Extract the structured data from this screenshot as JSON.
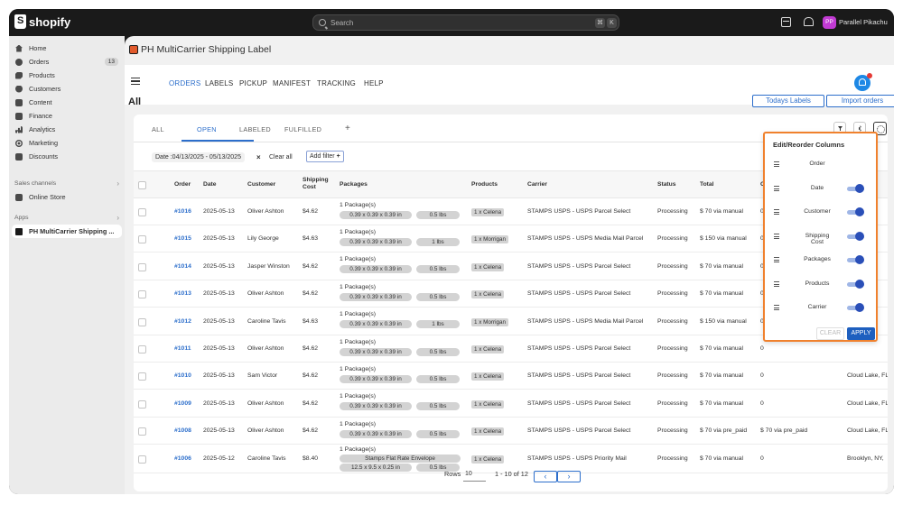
{
  "topbar": {
    "brand": "shopify",
    "search_placeholder": "Search",
    "shortcut": [
      "⌘",
      "K"
    ],
    "avatar_initials": "PP",
    "user_name": "Parallel Pikachu"
  },
  "sidebar": {
    "items": [
      {
        "label": "Home",
        "icon": "home-icon"
      },
      {
        "label": "Orders",
        "icon": "orders-icon",
        "badge": "13"
      },
      {
        "label": "Products",
        "icon": "tag-icon"
      },
      {
        "label": "Customers",
        "icon": "person-icon"
      },
      {
        "label": "Content",
        "icon": "content-icon"
      },
      {
        "label": "Finance",
        "icon": "finance-icon"
      },
      {
        "label": "Analytics",
        "icon": "analytics-icon"
      },
      {
        "label": "Marketing",
        "icon": "target-icon"
      },
      {
        "label": "Discounts",
        "icon": "discount-icon"
      }
    ],
    "sales_channels_label": "Sales channels",
    "online_store": "Online Store",
    "apps_label": "Apps",
    "app_item": "PH MultiCarrier Shipping ..."
  },
  "app": {
    "title": "PH MultiCarrier Shipping Label",
    "nav": [
      "ORDERS",
      "LABELS",
      "PICKUP",
      "MANIFEST",
      "TRACKING",
      "HELP"
    ],
    "page_heading": "All",
    "todays_labels": "Todays Labels",
    "import_orders": "Import orders",
    "help_badge": "1"
  },
  "tabs": [
    "ALL",
    "OPEN",
    "LABELED",
    "FULFILLED",
    "+"
  ],
  "filters": {
    "date_chip": "Date :04/13/2025 - 05/13/2025",
    "clear_all": "Clear all",
    "add_filter": "Add filter"
  },
  "table": {
    "headers": [
      "Order",
      "Date",
      "Customer",
      "Shipping Cost",
      "Packages",
      "Products",
      "Carrier",
      "Status",
      "Total",
      "Out"
    ],
    "rows": [
      {
        "order": "#1016",
        "date": "2025-05-13",
        "customer": "Oliver Ashton",
        "cost": "$4.62",
        "pkg": "1 Package(s)",
        "dims": "0.39 x 0.39 x 0.39 in",
        "weight": "0.5 lbs",
        "product": "1 x Celena",
        "carrier": "STAMPS USPS - USPS Parcel Select",
        "status": "Processing",
        "total": "$ 70 via manual",
        "out": "0",
        "extra": ""
      },
      {
        "order": "#1015",
        "date": "2025-05-13",
        "customer": "Lily George",
        "cost": "$4.63",
        "pkg": "1 Package(s)",
        "dims": "0.39 x 0.39 x 0.39 in",
        "weight": "1 lbs",
        "product": "1 x Morrigan",
        "carrier": "STAMPS USPS - USPS Media Mail Parcel",
        "status": "Processing",
        "total": "$ 150 via manual",
        "out": "0",
        "extra": ""
      },
      {
        "order": "#1014",
        "date": "2025-05-13",
        "customer": "Jasper Winston",
        "cost": "$4.62",
        "pkg": "1 Package(s)",
        "dims": "0.39 x 0.39 x 0.39 in",
        "weight": "0.5 lbs",
        "product": "1 x Celena",
        "carrier": "STAMPS USPS - USPS Parcel Select",
        "status": "Processing",
        "total": "$ 70 via manual",
        "out": "0",
        "extra": ""
      },
      {
        "order": "#1013",
        "date": "2025-05-13",
        "customer": "Oliver Ashton",
        "cost": "$4.62",
        "pkg": "1 Package(s)",
        "dims": "0.39 x 0.39 x 0.39 in",
        "weight": "0.5 lbs",
        "product": "1 x Celena",
        "carrier": "STAMPS USPS - USPS Parcel Select",
        "status": "Processing",
        "total": "$ 70 via manual",
        "out": "0",
        "extra": ""
      },
      {
        "order": "#1012",
        "date": "2025-05-13",
        "customer": "Caroline Tavis",
        "cost": "$4.63",
        "pkg": "1 Package(s)",
        "dims": "0.39 x 0.39 x 0.39 in",
        "weight": "1 lbs",
        "product": "1 x Morrigan",
        "carrier": "STAMPS USPS - USPS Media Mail Parcel",
        "status": "Processing",
        "total": "$ 150 via manual",
        "out": "0",
        "extra": ""
      },
      {
        "order": "#1011",
        "date": "2025-05-13",
        "customer": "Oliver Ashton",
        "cost": "$4.62",
        "pkg": "1 Package(s)",
        "dims": "0.39 x 0.39 x 0.39 in",
        "weight": "0.5 lbs",
        "product": "1 x Celena",
        "carrier": "STAMPS USPS - USPS Parcel Select",
        "status": "Processing",
        "total": "$ 70 via manual",
        "out": "0",
        "extra": ""
      },
      {
        "order": "#1010",
        "date": "2025-05-13",
        "customer": "Sam Victor",
        "cost": "$4.62",
        "pkg": "1 Package(s)",
        "dims": "0.39 x 0.39 x 0.39 in",
        "weight": "0.5 lbs",
        "product": "1 x Celena",
        "carrier": "STAMPS USPS - USPS Parcel Select",
        "status": "Processing",
        "total": "$ 70 via manual",
        "out": "0",
        "extra": "Cloud Lake, FL,"
      },
      {
        "order": "#1009",
        "date": "2025-05-13",
        "customer": "Oliver Ashton",
        "cost": "$4.62",
        "pkg": "1 Package(s)",
        "dims": "0.39 x 0.39 x 0.39 in",
        "weight": "0.5 lbs",
        "product": "1 x Celena",
        "carrier": "STAMPS USPS - USPS Parcel Select",
        "status": "Processing",
        "total": "$ 70 via manual",
        "out": "0",
        "extra": "Cloud Lake, FL,"
      },
      {
        "order": "#1008",
        "date": "2025-05-13",
        "customer": "Oliver Ashton",
        "cost": "$4.62",
        "pkg": "1 Package(s)",
        "dims": "0.39 x 0.39 x 0.39 in",
        "weight": "0.5 lbs",
        "product": "1 x Celena",
        "carrier": "STAMPS USPS - USPS Parcel Select",
        "status": "Processing",
        "total": "$ 70 via pre_paid",
        "out": "$ 70 via pre_paid",
        "extra": "Cloud Lake, FL,"
      },
      {
        "order": "#1006",
        "date": "2025-05-12",
        "customer": "Caroline Tavis",
        "cost": "$8.40",
        "pkg": "1 Package(s)",
        "dims": "Stamps Flat Rate Envelope",
        "dims2": "12.5 x 9.5 x 0.25 in",
        "weight": "0.5 lbs",
        "product": "1 x Celena",
        "carrier": "STAMPS USPS - USPS Priority Mail",
        "status": "Processing",
        "total": "$ 70 via manual",
        "out": "0",
        "extra": "Brooklyn, NY,"
      }
    ]
  },
  "pager": {
    "rows_label": "Rows",
    "rows_value": "10",
    "range": "1 - 10 of 12",
    "prev": "‹",
    "next": "›"
  },
  "panel": {
    "title": "Edit/Reorder Columns",
    "columns": [
      {
        "label": "Order",
        "toggle": false
      },
      {
        "label": "Date",
        "toggle": true
      },
      {
        "label": "Customer",
        "toggle": true
      },
      {
        "label": "Shipping Cost",
        "toggle": true
      },
      {
        "label": "Packages",
        "toggle": true
      },
      {
        "label": "Products",
        "toggle": true
      },
      {
        "label": "Carrier",
        "toggle": true
      }
    ],
    "clear": "CLEAR",
    "apply": "APPLY"
  },
  "colors": {
    "accent": "#2c6ecb",
    "panel_border": "#f0812d",
    "toggle_on": "#2a4fb8"
  }
}
